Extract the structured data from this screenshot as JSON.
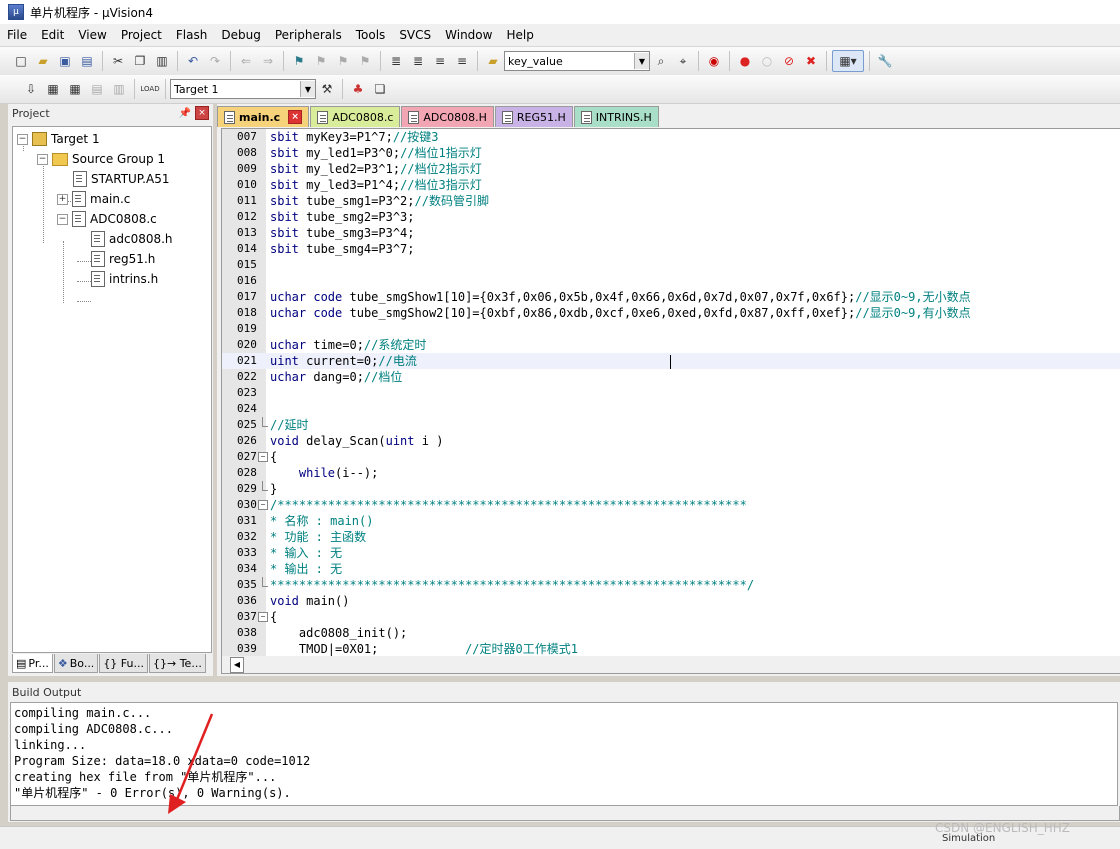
{
  "window": {
    "title": "单片机程序 - µVision4"
  },
  "menu": [
    "File",
    "Edit",
    "View",
    "Project",
    "Flash",
    "Debug",
    "Peripherals",
    "Tools",
    "SVCS",
    "Window",
    "Help"
  ],
  "toolbar": {
    "find_value": "key_value",
    "target": "Target 1",
    "load_label": "LOAD"
  },
  "project_panel": {
    "title": "Project",
    "tree": [
      {
        "label": "Target 1"
      },
      {
        "label": "Source Group 1"
      },
      {
        "label": "STARTUP.A51"
      },
      {
        "label": "main.c"
      },
      {
        "label": "ADC0808.c"
      },
      {
        "label": "adc0808.h"
      },
      {
        "label": "reg51.h"
      },
      {
        "label": "intrins.h"
      }
    ],
    "tabs": [
      "Pr...",
      "Bo...",
      "{} Fu...",
      "{}→ Te..."
    ]
  },
  "editor": {
    "tabs": [
      {
        "label": "main.c",
        "color": "#f6d27a"
      },
      {
        "label": "ADC0808.c",
        "color": "#d9ec9a"
      },
      {
        "label": "ADC0808.H",
        "color": "#f2a6b4"
      },
      {
        "label": "REG51.H",
        "color": "#c9b3e6"
      },
      {
        "label": "INTRINS.H",
        "color": "#a9dfc8"
      }
    ],
    "lines": [
      {
        "n": "007",
        "code": "sbit myKey3=P1^7;",
        "comment": "//按键3"
      },
      {
        "n": "008",
        "code": "sbit my_led1=P3^0;",
        "comment": "//档位1指示灯"
      },
      {
        "n": "009",
        "code": "sbit my_led2=P3^1;",
        "comment": "//档位2指示灯"
      },
      {
        "n": "010",
        "code": "sbit my_led3=P1^4;",
        "comment": "//档位3指示灯"
      },
      {
        "n": "011",
        "code": "sbit tube_smg1=P3^2;",
        "comment": "//数码管引脚"
      },
      {
        "n": "012",
        "code": "sbit tube_smg2=P3^3;",
        "comment": ""
      },
      {
        "n": "013",
        "code": "sbit tube_smg3=P3^4;",
        "comment": ""
      },
      {
        "n": "014",
        "code": "sbit tube_smg4=P3^7;",
        "comment": ""
      },
      {
        "n": "015",
        "code": "",
        "comment": ""
      },
      {
        "n": "016",
        "code": "",
        "comment": ""
      },
      {
        "n": "017",
        "code": "uchar code tube_smgShow1[10]={0x3f,0x06,0x5b,0x4f,0x66,0x6d,0x7d,0x07,0x7f,0x6f};",
        "comment": "//显示0~9,无小数点"
      },
      {
        "n": "018",
        "code": "uchar code tube_smgShow2[10]={0xbf,0x86,0xdb,0xcf,0xe6,0xed,0xfd,0x87,0xff,0xef};",
        "comment": "//显示0~9,有小数点"
      },
      {
        "n": "019",
        "code": "",
        "comment": ""
      },
      {
        "n": "020",
        "code": "uchar time=0;",
        "comment": "//系统定时"
      },
      {
        "n": "021",
        "code": "uint current=0;",
        "comment": "//电流"
      },
      {
        "n": "022",
        "code": "uchar dang=0;",
        "comment": "//档位"
      },
      {
        "n": "023",
        "code": "",
        "comment": ""
      },
      {
        "n": "024",
        "code": "",
        "comment": ""
      },
      {
        "n": "025",
        "code": "",
        "comment": "//延时"
      },
      {
        "n": "026",
        "code": "void delay_Scan(uint i )",
        "comment": ""
      },
      {
        "n": "027",
        "code": "{",
        "comment": ""
      },
      {
        "n": "028",
        "code": "    while(i--);",
        "comment": ""
      },
      {
        "n": "029",
        "code": "}",
        "comment": ""
      },
      {
        "n": "030",
        "code": "",
        "comment": "/*****************************************************************"
      },
      {
        "n": "031",
        "code": "",
        "comment": "* 名称 : main()"
      },
      {
        "n": "032",
        "code": "",
        "comment": "* 功能 : 主函数"
      },
      {
        "n": "033",
        "code": "",
        "comment": "* 输入 : 无"
      },
      {
        "n": "034",
        "code": "",
        "comment": "* 输出 : 无"
      },
      {
        "n": "035",
        "code": "",
        "comment": "******************************************************************/"
      },
      {
        "n": "036",
        "code": "void main()",
        "comment": ""
      },
      {
        "n": "037",
        "code": "{",
        "comment": ""
      },
      {
        "n": "038",
        "code": "    adc0808_init();",
        "comment": ""
      },
      {
        "n": "039",
        "code": "    TMOD|=0X01;            ",
        "comment": "//定时器0工作模式1"
      }
    ]
  },
  "build_output": {
    "title": "Build Output",
    "lines": [
      "compiling main.c...",
      "compiling ADC0808.c...",
      "linking...",
      "Program Size: data=18.0 xdata=0 code=1012",
      "creating hex file from \"单片机程序\"...",
      "\"单片机程序\" - 0 Error(s), 0 Warning(s)."
    ]
  },
  "status": {
    "mode": "Simulation",
    "watermark": "CSDN @ENGLISH_HHZ"
  },
  "colors": {
    "annotation_arrow": "#e02020",
    "comment": "#008080",
    "keyword": "#00007f"
  }
}
